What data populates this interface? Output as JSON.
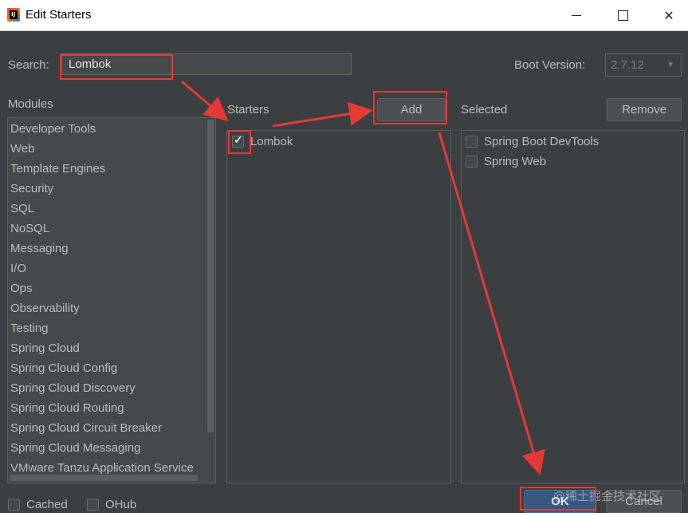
{
  "window": {
    "title": "Edit Starters"
  },
  "search": {
    "label": "Search:",
    "value": "Lombok"
  },
  "boot_version": {
    "label": "Boot Version:",
    "value": "2.7.12"
  },
  "modules": {
    "heading": "Modules",
    "items": [
      "Developer Tools",
      "Web",
      "Template Engines",
      "Security",
      "SQL",
      "NoSQL",
      "Messaging",
      "I/O",
      "Ops",
      "Observability",
      "Testing",
      "Spring Cloud",
      "Spring Cloud Config",
      "Spring Cloud Discovery",
      "Spring Cloud Routing",
      "Spring Cloud Circuit Breaker",
      "Spring Cloud Messaging",
      "VMware Tanzu Application Service"
    ]
  },
  "starters": {
    "heading": "Starters",
    "add_label": "Add",
    "items": [
      {
        "label": "Lombok",
        "checked": true
      }
    ]
  },
  "selected": {
    "heading": "Selected",
    "remove_label": "Remove",
    "items": [
      {
        "label": "Spring Boot DevTools",
        "checked": false
      },
      {
        "label": "Spring Web",
        "checked": false
      }
    ]
  },
  "footer": {
    "cached_label": "Cached",
    "ohub_label": "OHub",
    "ok_label": "OK",
    "cancel_label": "Cancel"
  },
  "watermark": "@稀土掘金技术社区",
  "colors": {
    "annotation_red": "#e53935",
    "accent_blue": "#365880"
  }
}
